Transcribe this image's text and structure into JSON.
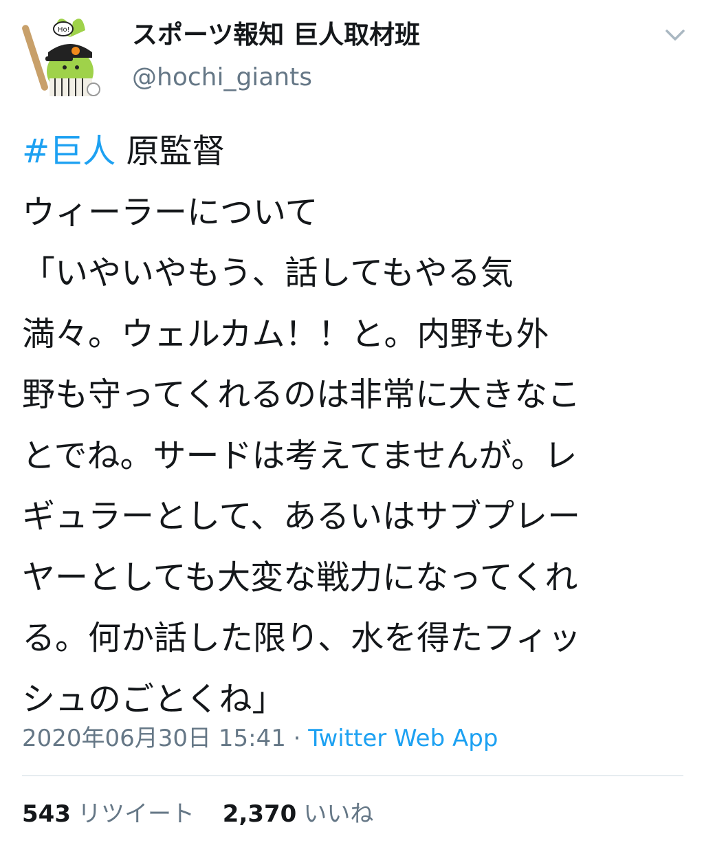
{
  "author": {
    "display_name": "スポーツ報知 巨人取材班",
    "handle": "@hochi_giants",
    "avatar_icon": "giants-mascot-avatar-icon"
  },
  "menu": {
    "caret_icon": "chevron-down-icon"
  },
  "tweet": {
    "hashtag": "#巨人",
    "lines": [
      " 原監督",
      "ウィーラーについて",
      "「いやいやもう、話してもやる気",
      "満々。ウェルカム！！と。内野も外",
      "野も守ってくれるのは非常に大きなこ",
      "とでね。サードは考えてませんが。レ",
      "ギュラーとして、あるいはサブプレー",
      "ヤーとしても大変な戦力になってくれ",
      "る。何か話した限り、水を得たフィッ",
      "シュのごとくね」"
    ]
  },
  "meta": {
    "timestamp": "2020年06月30日 15:41",
    "separator": " · ",
    "source": "Twitter Web App"
  },
  "stats": {
    "retweets_count": "543",
    "retweets_label": "リツイート",
    "likes_count": "2,370",
    "likes_label": "いいね"
  },
  "colors": {
    "link": "#1da1f2",
    "secondary_text": "#657786",
    "primary_text": "#14171a",
    "divider": "#e6ecf0"
  }
}
